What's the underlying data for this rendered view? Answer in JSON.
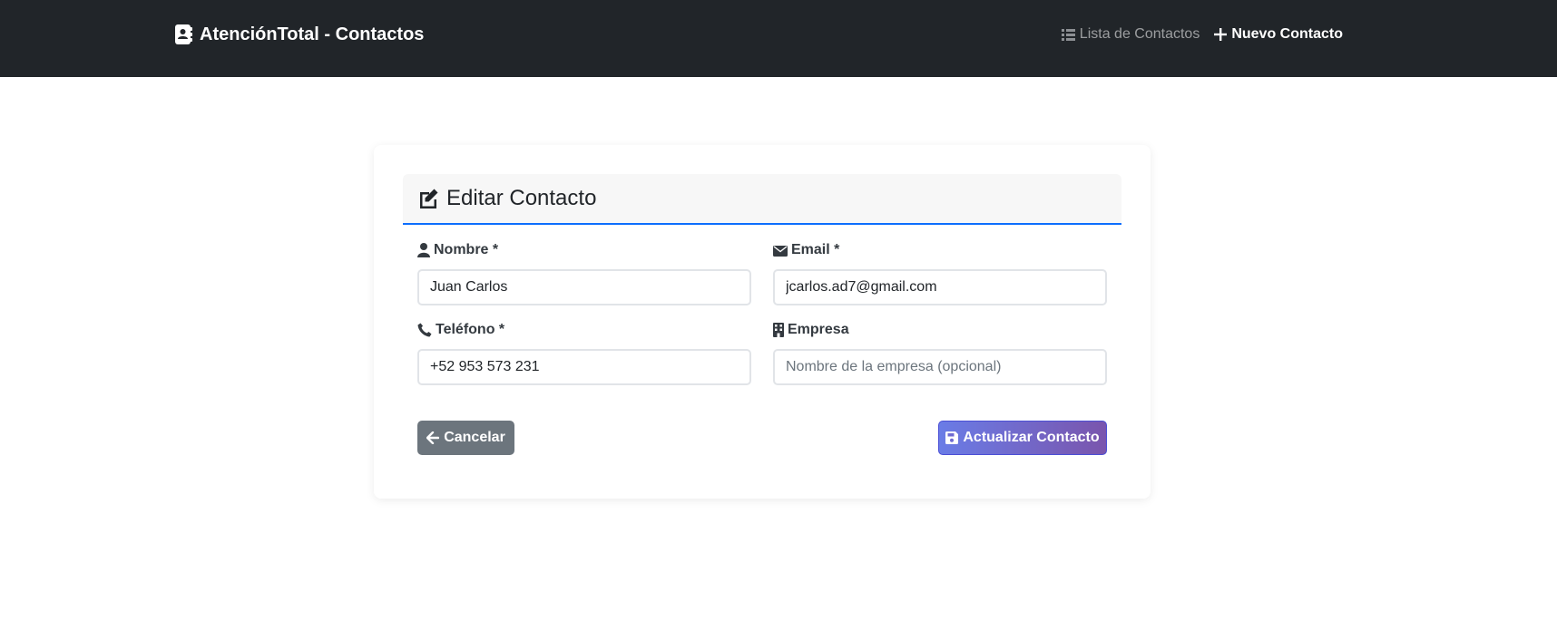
{
  "navbar": {
    "brand": "AtenciónTotal - Contactos",
    "links": [
      {
        "label": "Lista de Contactos",
        "icon": "list-icon",
        "active": false
      },
      {
        "label": "Nuevo Contacto",
        "icon": "plus-icon",
        "active": true
      }
    ]
  },
  "card": {
    "title": "Editar Contacto",
    "fields": {
      "nombre": {
        "label": "Nombre *",
        "value": "Juan Carlos",
        "placeholder": ""
      },
      "email": {
        "label": "Email *",
        "value": "jcarlos.ad7@gmail.com",
        "placeholder": ""
      },
      "telefono": {
        "label": "Teléfono *",
        "value": "+52 953 573 231",
        "placeholder": ""
      },
      "empresa": {
        "label": "Empresa",
        "value": "",
        "placeholder": "Nombre de la empresa (opcional)"
      }
    },
    "buttons": {
      "cancel": "Cancelar",
      "update": "Actualizar Contacto"
    }
  },
  "colors": {
    "navbar": "#212529",
    "accent": "#0d6efd",
    "cancel": "#6c757d",
    "update_start": "#6a7ce6",
    "update_end": "#7a55ad"
  }
}
